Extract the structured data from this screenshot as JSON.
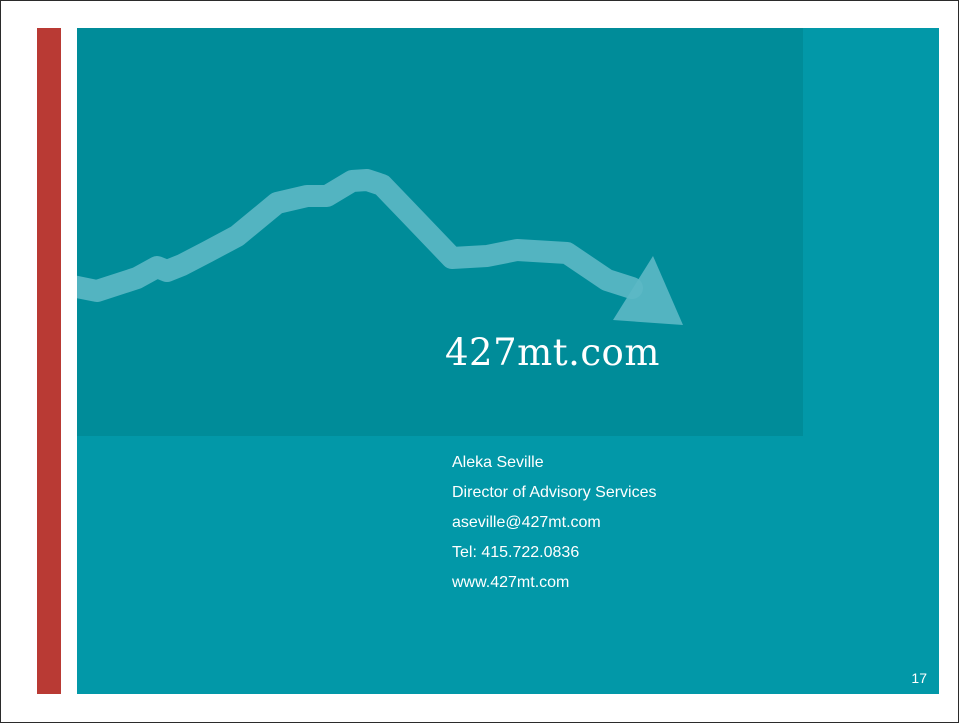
{
  "slide": {
    "logo_text": "427mt.com",
    "contact": {
      "name": "Aleka Seville",
      "title": "Director of Advisory Services",
      "email": "aseville@427mt.com",
      "phone": "Tel: 415.722.0836",
      "website": "www.427mt.com"
    },
    "page_number": "17"
  },
  "colors": {
    "accent_bar": "#b93a34",
    "slide_background": "#0298a8",
    "hero_background": "#008c99",
    "trend_arrow": "#5cb8c5"
  },
  "icons": {
    "hero_graphic": "downward-trend-arrow"
  }
}
